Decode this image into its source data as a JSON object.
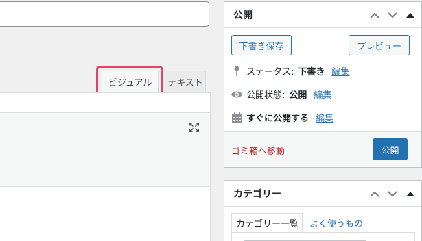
{
  "editor": {
    "tabs": {
      "visual": "ビジュアル",
      "text": "テキスト"
    },
    "highlight_color": "#e8426a"
  },
  "publish": {
    "title": "公開",
    "save_draft": "下書き保存",
    "preview": "プレビュー",
    "status_label": "ステータス:",
    "status_value": "下書き",
    "visibility_label": "公開状態:",
    "visibility_value": "公開",
    "schedule_text": "すぐに公開する",
    "edit_link": "編集",
    "trash": "ゴミ箱へ移動",
    "publish_button": "公開",
    "accent_color": "#2271b1"
  },
  "category": {
    "title": "カテゴリー",
    "tab_all": "カテゴリー一覧",
    "tab_popular": "よく使うもの"
  }
}
